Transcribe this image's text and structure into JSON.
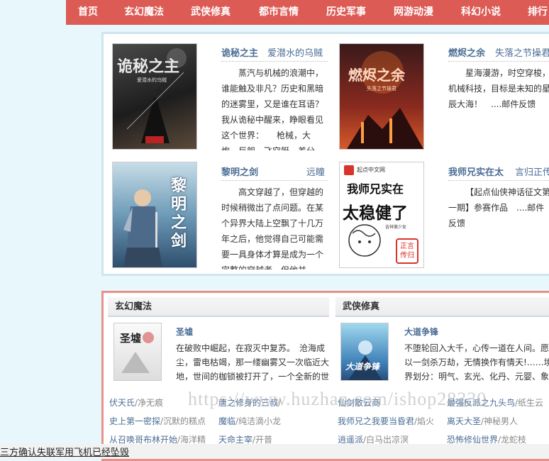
{
  "nav": {
    "items": [
      "首页",
      "玄幻魔法",
      "武侠修真",
      "都市言情",
      "历史军事",
      "网游动漫",
      "科幻小说",
      "排行"
    ]
  },
  "featured": {
    "books": [
      {
        "title": "诡秘之主",
        "author": "爱潜水的乌贼",
        "desc": "蒸汽与机械的浪潮中，谁能触及非凡？历史和黑暗的迷雾里，又是谁在耳语？我从诡秘中醒来，睁眼看见这个世界：　　枪械，大炮，巨舰，飞空艇，差分",
        "cover_text": "诡秘之主",
        "cover_sub": "爱潜水的乌贼"
      },
      {
        "title": "燃烬之余",
        "author": "失落之节操君",
        "desc": "星海漫游，时空穿梭，机械科技，目标是未知的星辰大海！　....邮件反馈",
        "cover_text": "燃烬之余",
        "cover_sub": "失落之节操君"
      },
      {
        "title": "黎明之剑",
        "author": "远瞳",
        "desc": "高文穿越了，但穿越的时候稍微出了点问题。在某个异界大陆上空飘了十几万年之后，他觉得自己可能需要一具身体才算是成为一个完整的穿越者，但他并",
        "cover_text": "黎明之剑",
        "cover_sub": ""
      },
      {
        "title": "我师兄实在太",
        "author": "言归正传",
        "desc": "【起点仙侠神话征文第一期】参赛作品　....邮件反馈",
        "cover_top": "起点中文网",
        "cover_line1": "我师兄实在",
        "cover_line2": "太稳健了",
        "cover_small": "吉祥美少女",
        "cover_stamp": "正言传归"
      }
    ]
  },
  "categories": [
    {
      "name": "玄幻魔法",
      "feature": {
        "title": "圣墟",
        "desc": "在破败中崛起，在寂灭中复苏。　沧海成尘，雷电枯竭，那一缕幽雾又一次临近大地，世间的枷锁被打开了，一个全新的世",
        "cover_text": "圣墟"
      },
      "list": [
        [
          {
            "t": "伏天氏",
            "a": "/净无痕"
          },
          {
            "t": "唐之修身的三叔",
            "a": "/"
          }
        ],
        [
          {
            "t": "史上第一密探",
            "a": "/沉默的糕点"
          },
          {
            "t": "魔临",
            "a": "/纯洁滴小龙"
          }
        ],
        [
          {
            "t": "从召唤哥布林开始",
            "a": "/海洋精"
          },
          {
            "t": "天命主宰",
            "a": "/开普"
          }
        ]
      ]
    },
    {
      "name": "武侠修真",
      "feature": {
        "title": "大道争锋",
        "desc": "不堕轮回入大千，心传一道在人间。愿以一剑杀万劫，无情换作有情天!……境界划分：明气、玄光、化丹、元婴、象相",
        "cover_text": "大道争锋"
      },
      "list": [
        [
          {
            "t": "仙剑散云商",
            "a": ""
          },
          {
            "t": "最强反派之九头鸟",
            "a": "/纸生云"
          }
        ],
        [
          {
            "t": "我师兄之我要当昏君",
            "a": "/焰火"
          },
          {
            "t": "离天大圣",
            "a": "/神秘男人"
          }
        ],
        [
          {
            "t": "逍遥派",
            "a": "/白马出凉溟"
          },
          {
            "t": "恐怖修仙世界",
            "a": "/龙蛇枝"
          }
        ]
      ]
    }
  ],
  "watermark": "https://www.huzhan.com/ishop28330",
  "bottom_link": "三方确认失联军用飞机已经坠毁",
  "colors": {
    "nav_bg": "#dc5b55",
    "link": "#4b6d95",
    "page_bg": "#e7f7fb"
  }
}
